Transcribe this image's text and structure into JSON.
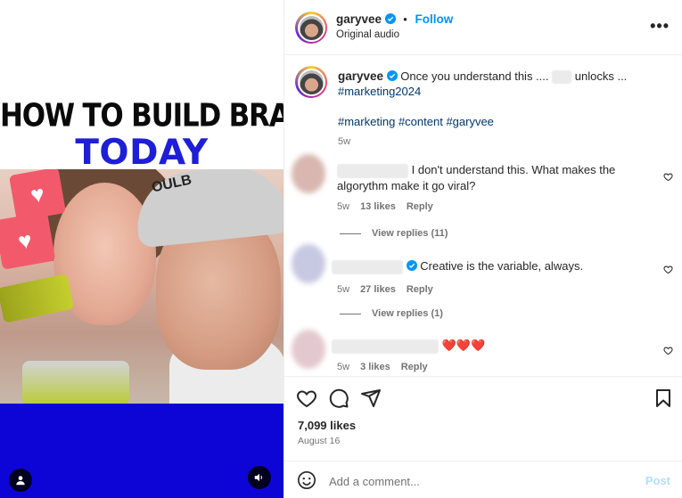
{
  "media": {
    "headline_line1": "HOW TO BUILD BRAND",
    "headline_line2": "TODAY",
    "cap_text": "OULB",
    "heart_glyph": "♥",
    "colors": {
      "headline_blue": "#1e1ed8",
      "bottom_band": "#0d05d6",
      "heart_bubble": "#f25a6c"
    }
  },
  "header": {
    "username": "garyvee",
    "follow_label": "Follow",
    "separator": "•",
    "audio": "Original audio",
    "more_glyph": "•••"
  },
  "caption": {
    "username": "garyvee",
    "text_before": "Once you understand this ....",
    "text_after": "unlocks ...",
    "hashtag_line1": "#marketing2024",
    "hashtags": [
      "#marketing",
      "#content",
      "#garyvee"
    ],
    "age": "5w"
  },
  "comments": [
    {
      "text": "I don't understand this. What makes the algorythm make it go viral?",
      "age": "5w",
      "likes": "13 likes",
      "reply": "Reply",
      "verified": false
    },
    {
      "text": "Creative is the variable, always.",
      "age": "5w",
      "likes": "27 likes",
      "reply": "Reply",
      "verified": true
    },
    {
      "text": "❤️❤️❤️",
      "age": "5w",
      "likes": "3 likes",
      "reply": "Reply",
      "verified": false
    }
  ],
  "view_replies": [
    "View replies (11)",
    "View replies (1)"
  ],
  "footer": {
    "likes_count": "7,099 likes",
    "date": "August 16",
    "comment_placeholder": "Add a comment...",
    "post_label": "Post"
  },
  "colors": {
    "link_blue": "#0095f6",
    "hashtag": "#00376b",
    "muted": "#737373",
    "heart_red": "#ff3040"
  }
}
